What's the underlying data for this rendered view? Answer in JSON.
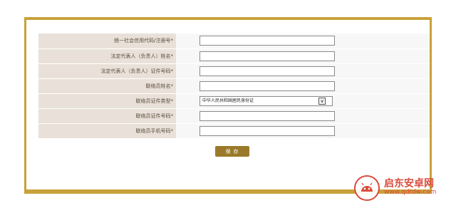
{
  "form": {
    "fields": [
      {
        "label": "统一社会信用代码/注册号*",
        "type": "text",
        "value": ""
      },
      {
        "label": "法定代表人（负责人）姓名*",
        "type": "text",
        "value": ""
      },
      {
        "label": "法定代表人（负责人）证件号码*",
        "type": "text",
        "value": ""
      },
      {
        "label": "联络员姓名*",
        "type": "text",
        "value": ""
      },
      {
        "label": "联络员证件类型*",
        "type": "select",
        "value": "中华人民共和国居民身份证"
      },
      {
        "label": "联络员证件号码*",
        "type": "text",
        "value": ""
      },
      {
        "label": "联络员手机号码*",
        "type": "text",
        "value": ""
      }
    ],
    "select_arrow": "∨"
  },
  "save_button": {
    "label": "保 存"
  },
  "watermark": {
    "title": "启东安卓网",
    "url": "www.qdtdw.com",
    "icon": "android-logo-icon"
  },
  "colors": {
    "frame": "#c9a13b",
    "label_bg": "#e9e1d9",
    "input_bg": "#f7f7f7",
    "button": "#9a7a2a",
    "watermark": "#d94b3b"
  }
}
